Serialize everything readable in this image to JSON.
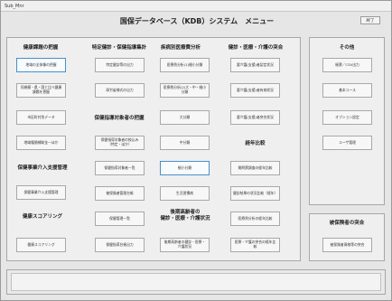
{
  "window": {
    "title": "Sub_Mnr"
  },
  "header": {
    "title": "国保データベース（KDB）システム　メニュー",
    "close_label": "終了"
  },
  "columns": {
    "health_issues": "健康課題の把握",
    "specific_checkup": "特定健診・保健指導集計",
    "disease_analysis": "疾病別医療費分析",
    "checkup_care": "健診・医療・介護の突合",
    "other": "その他"
  },
  "sections": {
    "health_guidance_target": "保健指導対象者の把握",
    "health_program": "保健事業介入支援管理",
    "health_scoring": "健康スコアリング",
    "elderly": "後期高齢者の\n健診・医療・介護状況",
    "yearly": "経年比較",
    "insured": "被保険者の突合"
  },
  "buttons": {
    "col1": [
      "地域の全体像の把握",
      "同規模・県・国と比べ健康課題を把握",
      "市区町村別データ",
      "地域権間補助金一ほか",
      "保健事業介入支援管理",
      "健康スコアリング"
    ],
    "col2": [
      "特定健診等の出力",
      "厚労省様式の出力",
      "保健指導対象者の絞込み（特定・ほか）",
      "保健指導対象者一覧",
      "被保険者管理台帳",
      "保健管理一覧",
      "保健指導台帳出力"
    ],
    "col3": [
      "医療費分析(1)細小分類",
      "医療費分析(2)大・中・細小分類",
      "大分類",
      "中分類",
      "細小分類",
      "生活習慣病",
      "後期高齢者の健診・医療・介護状況"
    ],
    "col4": [
      "要介護(支援)者認定状況",
      "要介護(支援)者有病状況",
      "要介護(支援)者突合状況",
      "質問票調査の経年比較",
      "健診結果の状況比較（経年）",
      "医療費分析の経年比較",
      "医療・介護の突合の経年比較"
    ],
    "col5": [
      "帳票／CSV出力",
      "基本コース",
      "オプション設定",
      "ユーザ管理",
      "被保険者資格等の突合"
    ]
  }
}
